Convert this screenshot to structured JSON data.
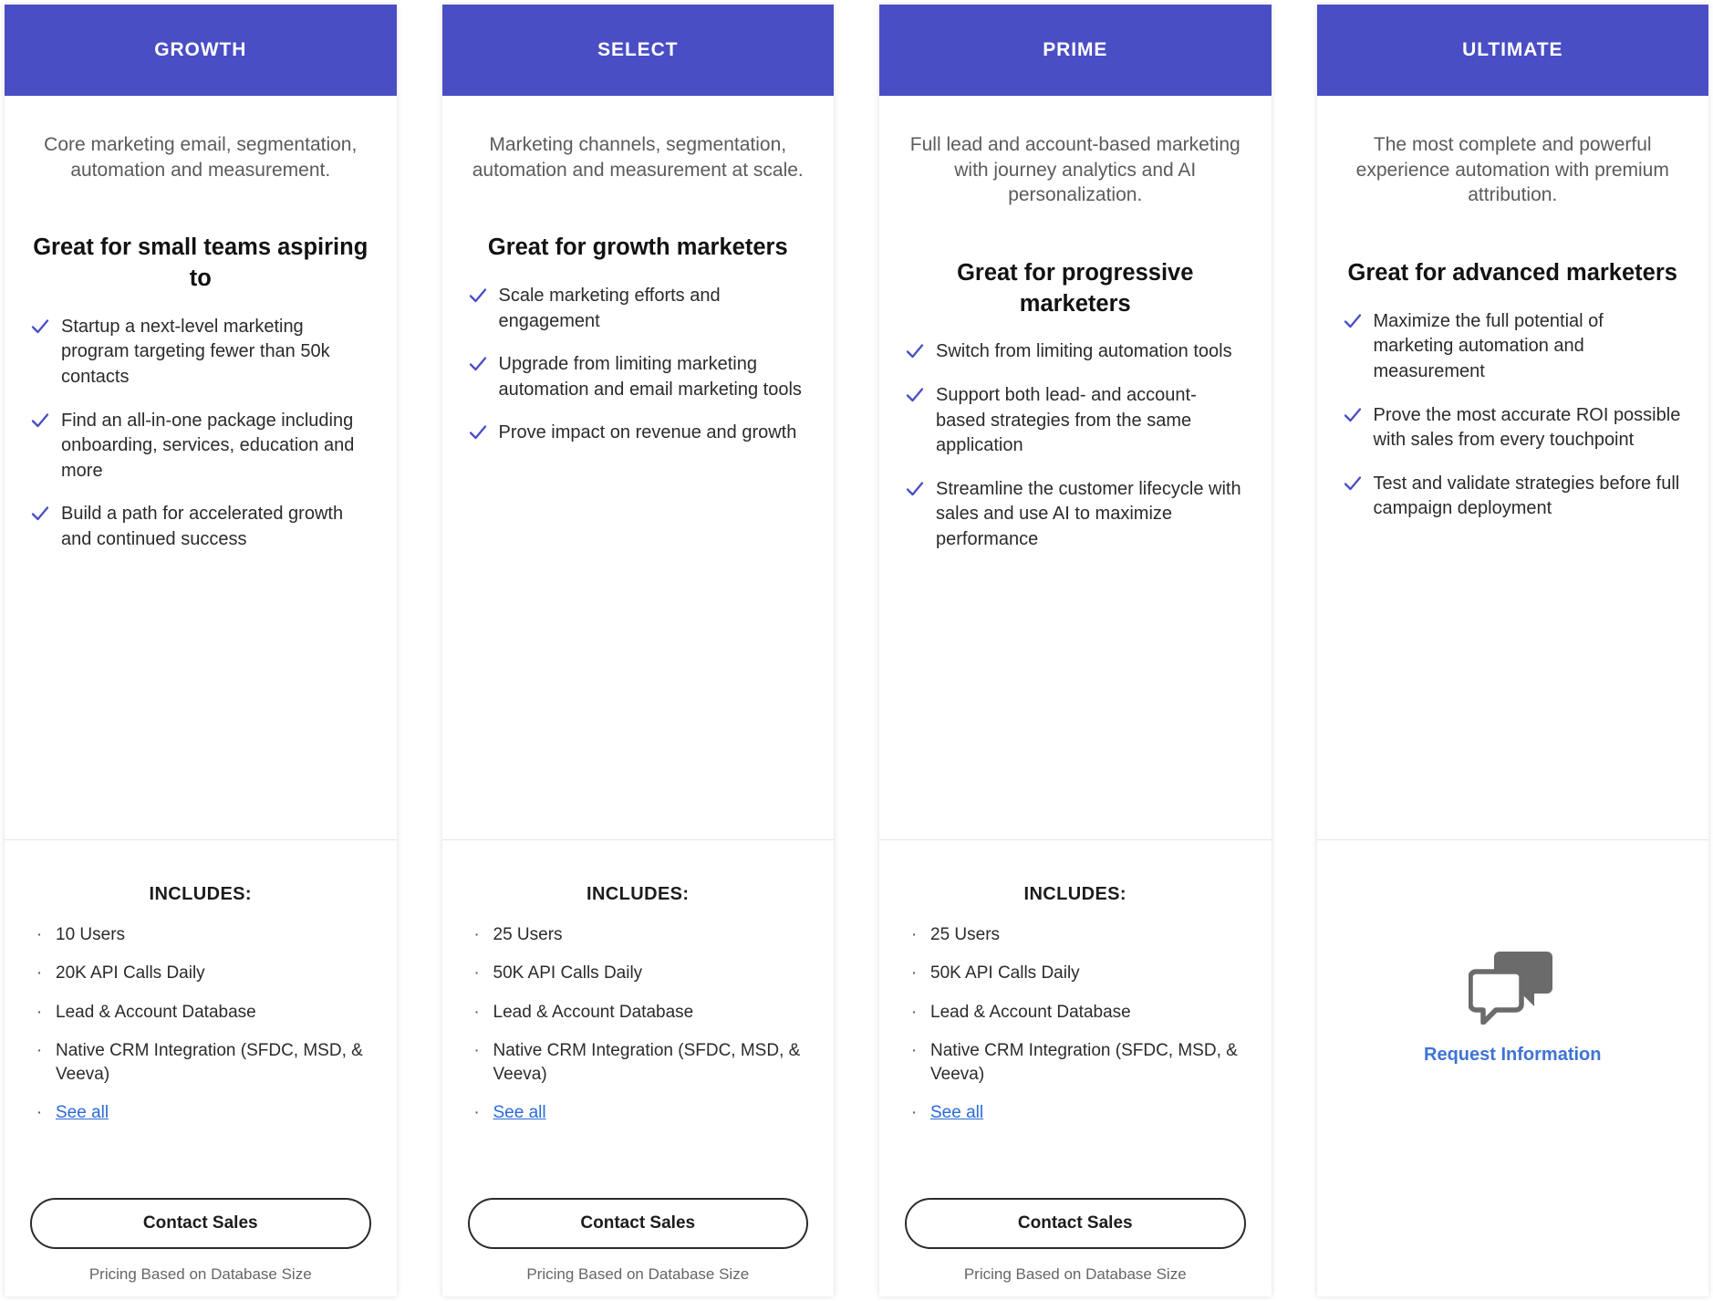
{
  "theme": {
    "header_bg": "#4a4ec4",
    "check_color": "#4a4ec4",
    "link_color": "#2a6bd6",
    "request_link_color": "#3f73d6",
    "card_bg": "#ffffff"
  },
  "common": {
    "includes_title": "INCLUDES:",
    "contact_button_label": "Contact Sales",
    "pricing_note": "Pricing Based on Database Size",
    "see_all_label": "See all",
    "bullet_glyph": "·",
    "check_icon_name": "check-icon"
  },
  "plans": [
    {
      "name": "GROWTH",
      "summary": "Core marketing email, segmentation, automation and measurement.",
      "tagline": "Great for small teams aspiring to",
      "benefits": [
        "Startup a next-level marketing program targeting fewer than 50k contacts",
        "Find an all-in-one package including onboarding, services, education and more",
        "Build a path for accelerated growth and continued success"
      ],
      "includes": [
        "10 Users",
        "20K API Calls Daily",
        "Lead & Account Database",
        "Native CRM Integration (SFDC, MSD, & Veeva)"
      ],
      "has_see_all": true,
      "has_contact_button": true,
      "has_request_information": false
    },
    {
      "name": "SELECT",
      "summary": "Marketing channels, segmentation, automation and measurement at scale.",
      "tagline": "Great for growth marketers",
      "benefits": [
        "Scale marketing efforts and engagement",
        "Upgrade from limiting marketing automation and email marketing tools",
        "Prove impact on revenue and growth"
      ],
      "includes": [
        "25 Users",
        "50K API Calls Daily",
        "Lead & Account Database",
        "Native CRM Integration (SFDC, MSD, & Veeva)"
      ],
      "has_see_all": true,
      "has_contact_button": true,
      "has_request_information": false
    },
    {
      "name": "PRIME",
      "summary": "Full lead and account-based marketing with journey analytics and AI personalization.",
      "tagline": "Great for progressive marketers",
      "benefits": [
        "Switch from limiting automation tools",
        "Support both lead- and account-based strategies from the same application",
        "Streamline the customer lifecycle with sales and use AI to maximize performance"
      ],
      "includes": [
        "25 Users",
        "50K API Calls Daily",
        "Lead & Account Database",
        "Native CRM Integration (SFDC, MSD, & Veeva)"
      ],
      "has_see_all": true,
      "has_contact_button": true,
      "has_request_information": false
    },
    {
      "name": "ULTIMATE",
      "summary": "The most complete and powerful experience automation with premium attribution.",
      "tagline": "Great for advanced marketers",
      "benefits": [
        "Maximize the full potential of marketing automation and measurement",
        "Prove the most accurate ROI possible with sales from every touchpoint",
        "Test and validate strategies before full campaign deployment"
      ],
      "includes": [],
      "has_see_all": false,
      "has_contact_button": false,
      "has_request_information": true,
      "request_information_label": "Request Information",
      "request_icon_name": "chat-bubbles-icon"
    }
  ]
}
